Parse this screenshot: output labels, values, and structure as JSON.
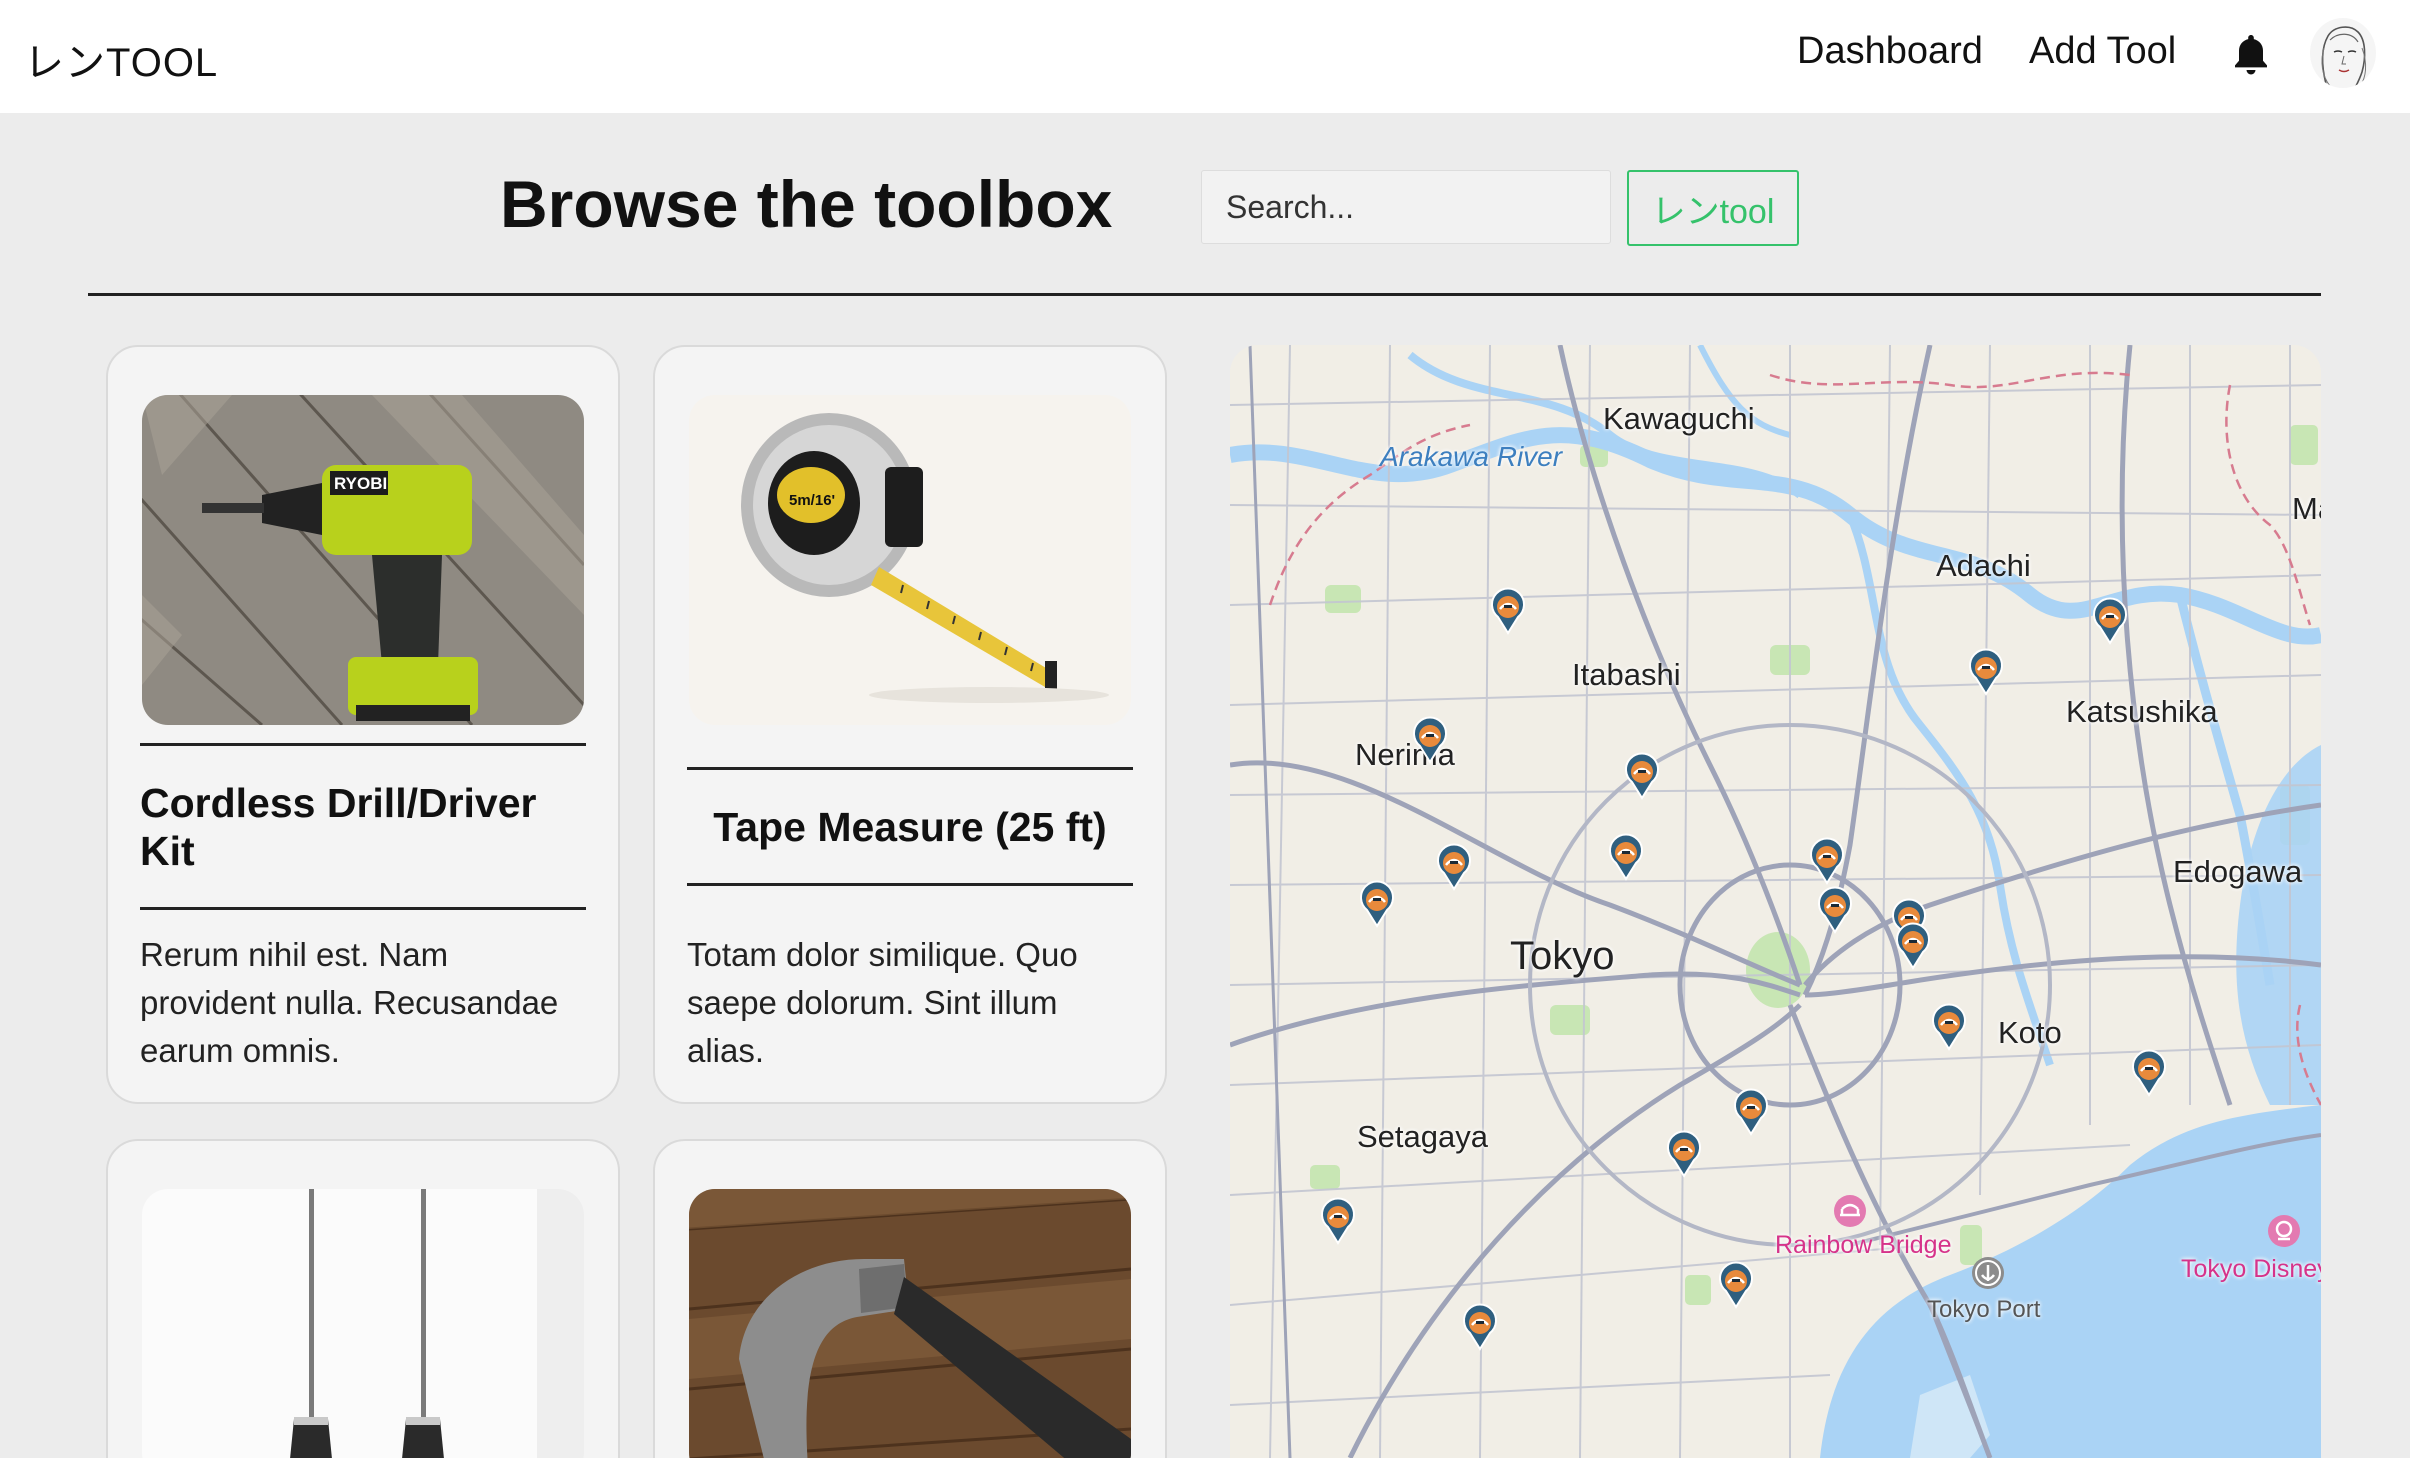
{
  "header": {
    "logo": "レンTOOL",
    "nav": {
      "dashboard": "Dashboard",
      "add_tool": "Add Tool"
    },
    "icons": {
      "bell": "bell-icon",
      "avatar": "user-avatar"
    }
  },
  "toolbar": {
    "title": "Browse the toolbox",
    "search_placeholder": "Search...",
    "brand_button": "レンtool"
  },
  "tools": [
    {
      "title_line1": "Cordless Drill/Driver",
      "title_line2": "Kit",
      "description_line1": "Rerum nihil est. Nam",
      "description_line2": "provident nulla. Recusandae",
      "description_line3": "earum omnis.",
      "image": "cordless-drill-photo"
    },
    {
      "title_line1": "Tape Measure (25 ft)",
      "description_line1": "Totam dolor similique. Quo",
      "description_line2": "saepe dolorum. Sint illum",
      "description_line3": "alias.",
      "image": "tape-measure-photo"
    },
    {
      "image": "screwdrivers-photo"
    },
    {
      "image": "hammer-photo"
    }
  ],
  "map": {
    "labels": {
      "kawaguchi": "Kawaguchi",
      "arakawa": "Arakawa River",
      "adachi": "Adachi",
      "itabashi": "Itabashi",
      "katsushika": "Katsushika",
      "nerima": "Nerima",
      "edogawa": "Edogawa",
      "tokyo": "Tokyo",
      "koto": "Koto",
      "setagaya": "Setagaya",
      "rainbow": "Rainbow Bridge",
      "port": "Tokyo Port",
      "disney": "Tokyo Disney",
      "ma": "Ma"
    },
    "pin_count": 19,
    "colors": {
      "water": "#aad3f5",
      "land": "#f1eee6",
      "road": "#b9bdcc",
      "park": "#c8e6b4"
    }
  },
  "colors": {
    "accent": "#35c26b",
    "background": "#ececec"
  }
}
